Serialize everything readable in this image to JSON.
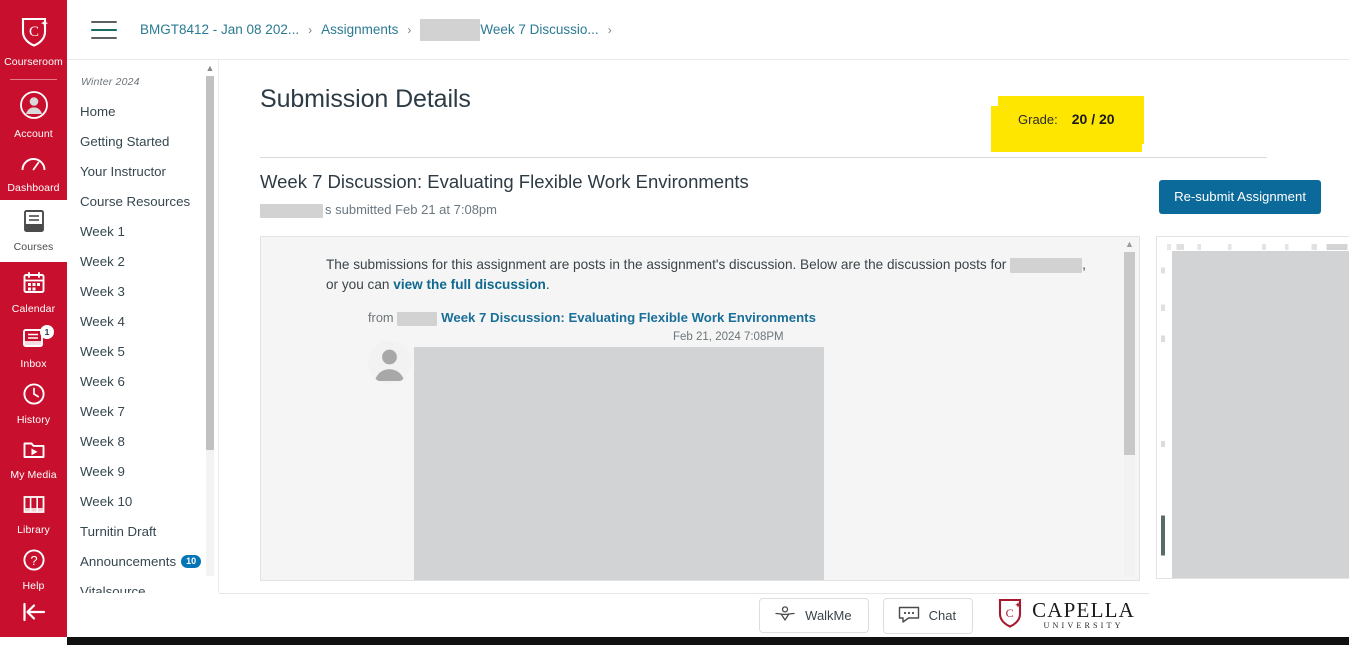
{
  "global_rail": {
    "items": [
      {
        "label": "Courseroom",
        "icon": "shield-c-logo-icon",
        "active": false,
        "badge": null
      },
      {
        "label": "Account",
        "icon": "user-circle-icon",
        "active": false,
        "badge": null
      },
      {
        "label": "Dashboard",
        "icon": "speedometer-icon",
        "active": false,
        "badge": null
      },
      {
        "label": "Courses",
        "icon": "book-icon",
        "active": true,
        "badge": null
      },
      {
        "label": "Calendar",
        "icon": "calendar-icon",
        "active": false,
        "badge": null
      },
      {
        "label": "Inbox",
        "icon": "inbox-tray-icon",
        "active": false,
        "badge": "1"
      },
      {
        "label": "History",
        "icon": "clock-icon",
        "active": false,
        "badge": null
      },
      {
        "label": "My Media",
        "icon": "video-folder-icon",
        "active": false,
        "badge": null
      },
      {
        "label": "Library",
        "icon": "books-icon",
        "active": false,
        "badge": null
      },
      {
        "label": "Help",
        "icon": "question-circle-icon",
        "active": false,
        "badge": null
      }
    ],
    "collapse_icon": "collapse-left-arrow-icon",
    "brand_color": "#c8102e"
  },
  "breadcrumb": {
    "menu_icon": "hamburger-menu-icon",
    "items": [
      {
        "label": "BMGT8412 - Jan 08 202...",
        "redacted": false
      },
      {
        "label": "Assignments",
        "redacted": false
      },
      {
        "label": "Week 7 Discussio...",
        "redacted": true
      }
    ],
    "separator": "›"
  },
  "course_nav": {
    "term": "Winter 2024",
    "items": [
      {
        "label": "Home",
        "badge": null
      },
      {
        "label": "Getting Started",
        "badge": null
      },
      {
        "label": "Your Instructor",
        "badge": null
      },
      {
        "label": "Course Resources",
        "badge": null
      },
      {
        "label": "Week 1",
        "badge": null
      },
      {
        "label": "Week 2",
        "badge": null
      },
      {
        "label": "Week 3",
        "badge": null
      },
      {
        "label": "Week 4",
        "badge": null
      },
      {
        "label": "Week 5",
        "badge": null
      },
      {
        "label": "Week 6",
        "badge": null
      },
      {
        "label": "Week 7",
        "badge": null
      },
      {
        "label": "Week 8",
        "badge": null
      },
      {
        "label": "Week 9",
        "badge": null
      },
      {
        "label": "Week 10",
        "badge": null
      },
      {
        "label": "Turnitin Draft",
        "badge": null
      },
      {
        "label": "Announcements",
        "badge": "10"
      },
      {
        "label": "Vitalsource",
        "badge": null
      }
    ]
  },
  "main": {
    "page_title": "Submission Details",
    "grade_label": "Grade:",
    "grade_value": "20 / 20",
    "grade_highlight_color": "#ffe600",
    "assignment_title": "Week 7 Discussion: Evaluating Flexible Work Environments",
    "submitted_meta": "s submitted Feb 21 at 7:08pm",
    "resubmit_label": "Re-submit Assignment",
    "resubmit_color": "#0c6a9a"
  },
  "preview": {
    "intro_part1": "The submissions for this assignment are posts in the assignment's discussion. Below are the discussion posts for ",
    "intro_part2": ", or you can ",
    "intro_link": "view the full discussion",
    "intro_part3": ".",
    "from_label": "from",
    "post_title": "Week 7 Discussion: Evaluating Flexible Work Environments",
    "post_date": "Feb 21, 2024 7:08PM",
    "avatar_icon": "default-user-avatar-icon",
    "scroll_up_icon": "scroll-up-arrow-icon"
  },
  "footer": {
    "walkme_label": "WalkMe",
    "walkme_icon": "walkme-icon",
    "chat_label": "Chat",
    "chat_icon": "chat-bubble-icon",
    "logo_name": "CAPELLA",
    "logo_sub": "UNIVERSITY",
    "logo_icon": "capella-shield-icon",
    "logo_color": "#a6192e"
  }
}
